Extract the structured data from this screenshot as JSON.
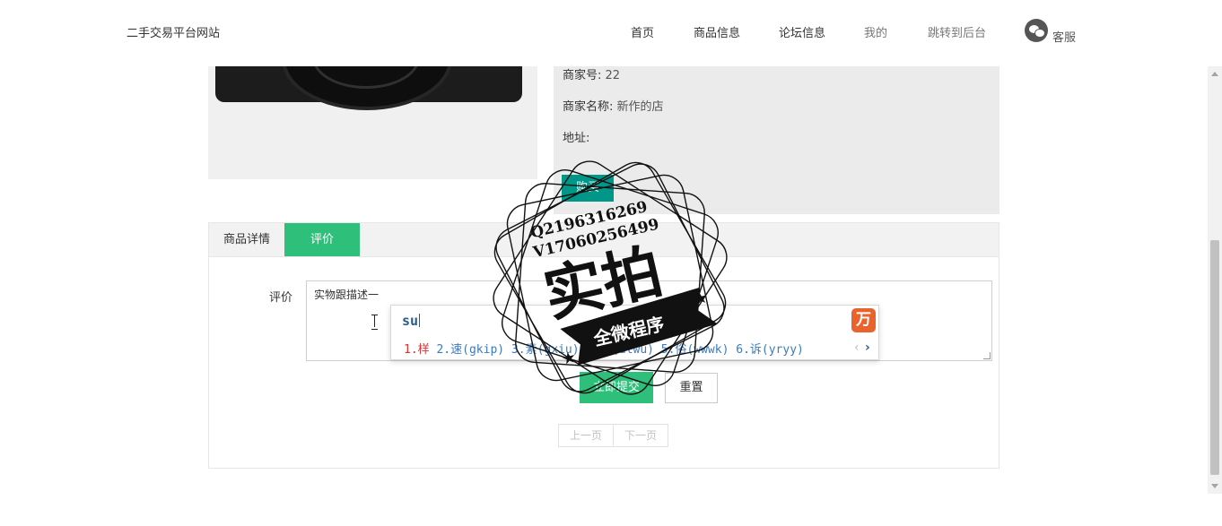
{
  "header": {
    "site_title": "二手交易平台网站",
    "nav": {
      "home": "首页",
      "goods": "商品信息",
      "forum": "论坛信息",
      "mine": "我的",
      "admin": "跳转到后台"
    },
    "service_label": "客服"
  },
  "product": {
    "merchant_no_label": "商家号:",
    "merchant_no": "22",
    "merchant_name_label": "商家名称:",
    "merchant_name": "新作的店",
    "address_label": "地址:",
    "address": "",
    "buy_label": "购买"
  },
  "tabs": {
    "detail": "商品详情",
    "review": "评价"
  },
  "review_form": {
    "label": "评价",
    "value": "实物跟描述一",
    "submit_label": "立即提交",
    "reset_label": "重置"
  },
  "pager": {
    "prev": "上一页",
    "next": "下一页"
  },
  "ime": {
    "composition": "su",
    "logo": "万",
    "candidates_first": "1.样",
    "candidates_rest": " 2.速(gkip) 3.素(gxiu) 4.苏(alwu) 5.俗(wwwk) 6.诉(yryy)"
  },
  "watermark": {
    "line1": "Q2196316269",
    "line2": "V17060256499",
    "main": "实拍",
    "banner": "全微程序"
  },
  "colors": {
    "accent_green": "#2ebf7a",
    "buy_teal": "#009688",
    "panel_gray": "#ebebeb"
  }
}
